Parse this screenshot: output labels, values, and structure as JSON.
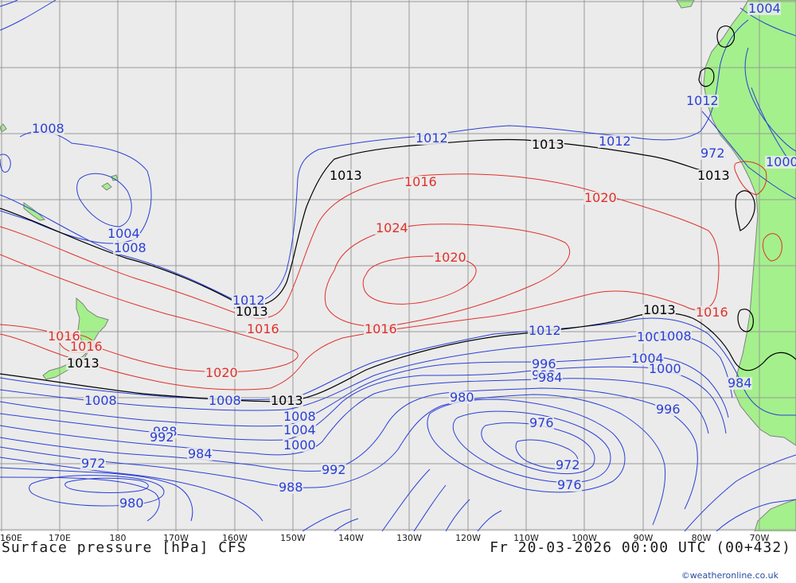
{
  "header": {
    "title": "Surface pressure [hPa] CFS",
    "valid_time": "Fr 20-03-2026 00:00 UTC (00+432)",
    "credit": "©weatheronline.co.uk"
  },
  "colors": {
    "ocean": "#ebebeb",
    "land": "#a4f08c",
    "grid": "#9a9a9a",
    "low_isobar": "#2a3fd6",
    "high_isobar": "#e0302a",
    "standard_isobar": "#000000",
    "coast": "#808080"
  },
  "axis": {
    "longitude_labels": [
      "160E",
      "170E",
      "180",
      "170W",
      "160W",
      "150W",
      "140W",
      "130W",
      "120W",
      "110W",
      "100W",
      "90W",
      "80W",
      "70W"
    ]
  },
  "isobar_labels": {
    "low": [
      "1008",
      "1012",
      "1008",
      "1004",
      "1008",
      "1012",
      "1012",
      "1008",
      "1008",
      "1012",
      "1004",
      "1000",
      "996",
      "992",
      "972",
      "984",
      "980",
      "976",
      "972",
      "1008",
      "1004",
      "1000",
      "992",
      "988",
      "1012",
      "1008",
      "1004",
      "1000",
      "996",
      "988",
      "984",
      "980",
      "976",
      "972",
      "984",
      "992",
      "1012"
    ],
    "standard": [
      "1013",
      "1013",
      "1013",
      "1013",
      "1013",
      "1013",
      "1013"
    ],
    "high": [
      "1016",
      "1020",
      "1024",
      "1020",
      "1016",
      "1016",
      "1020",
      "1016",
      "1016",
      "1016"
    ]
  }
}
